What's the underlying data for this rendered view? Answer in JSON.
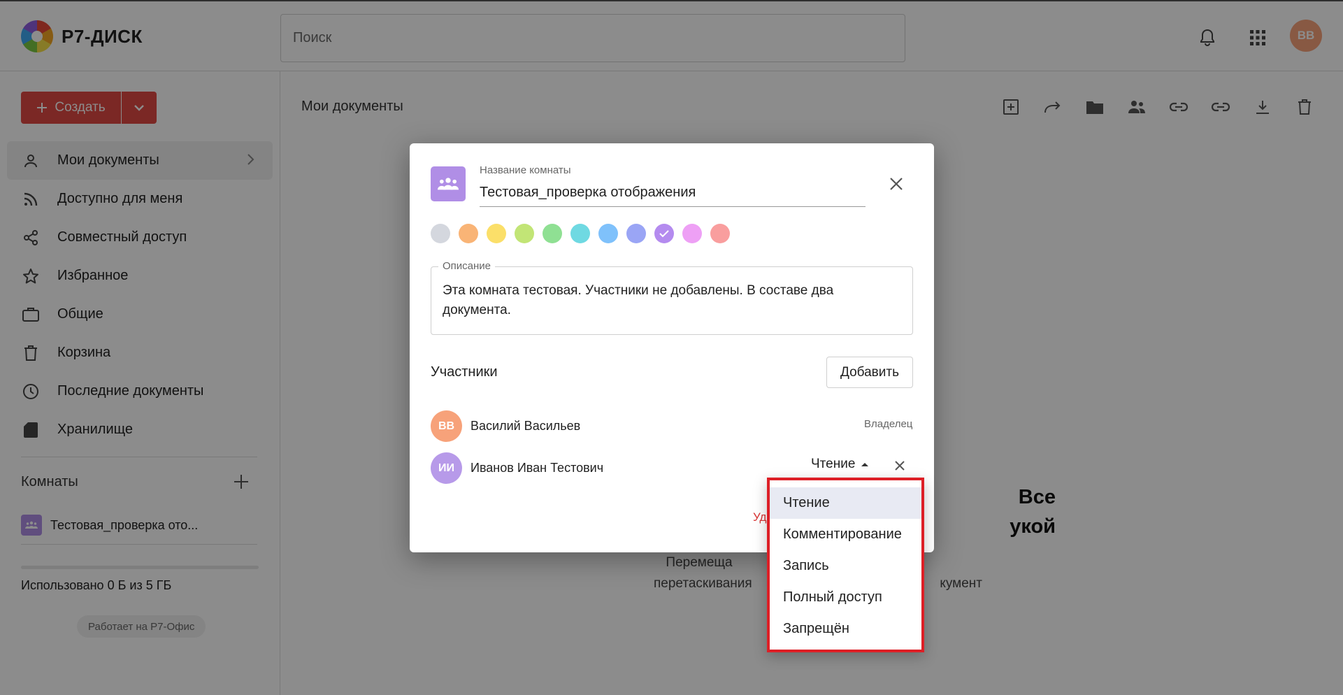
{
  "app": {
    "logo_text": "Р7-ДИСК",
    "user_initials": "ВВ"
  },
  "search": {
    "placeholder": "Поиск"
  },
  "sidebar": {
    "create_label": "Создать",
    "items": [
      {
        "label": "Мои документы",
        "icon": "person-icon",
        "active": true
      },
      {
        "label": "Доступно для меня",
        "icon": "rss-icon"
      },
      {
        "label": "Совместный доступ",
        "icon": "share-icon"
      },
      {
        "label": "Избранное",
        "icon": "star-icon"
      },
      {
        "label": "Общие",
        "icon": "briefcase-icon"
      },
      {
        "label": "Корзина",
        "icon": "trash-icon"
      },
      {
        "label": "Последние документы",
        "icon": "clock-icon"
      },
      {
        "label": "Хранилище",
        "icon": "sd-card-icon"
      }
    ],
    "rooms_title": "Комнаты",
    "rooms": [
      {
        "label": "Тестовая_проверка ото..."
      }
    ],
    "storage_text": "Использовано 0 Б из 5 ГБ",
    "storage_used_fraction": 0.0,
    "powered_by": "Работает на Р7-Офис"
  },
  "main": {
    "title": "Мои документы",
    "empty_title_lines": [
      "Все",
      "укой"
    ],
    "empty_desc_lines": [
      "Перемеща",
      "перетаскивания",
      "кумент"
    ]
  },
  "modal": {
    "name_label": "Название комнаты",
    "name_value": "Тестовая_проверка отображения",
    "colors": [
      "#d4d7de",
      "#f9b476",
      "#fbdf69",
      "#c2e576",
      "#8fe093",
      "#6fd9e2",
      "#7fc1fb",
      "#9aa5f5",
      "#b48bef",
      "#eea0f5",
      "#f99e9e"
    ],
    "selected_color_index": 8,
    "description_label": "Описание",
    "description_text": "Эта комната тестовая. Участники не добавлены. В составе два документа.",
    "members_title": "Участники",
    "add_button": "Добавить",
    "members": [
      {
        "initials": "ВВ",
        "name": "Василий Васильев",
        "role": "Владелец",
        "color": "#f7a27a"
      },
      {
        "initials": "ИИ",
        "name": "Иванов Иван Тестович",
        "role": "Чтение",
        "color": "#b79ae9"
      }
    ],
    "partial_red_text": "Уд"
  },
  "role_dropdown": {
    "options": [
      "Чтение",
      "Комментирование",
      "Запись",
      "Полный доступ",
      "Запрещён"
    ],
    "selected_index": 0
  }
}
